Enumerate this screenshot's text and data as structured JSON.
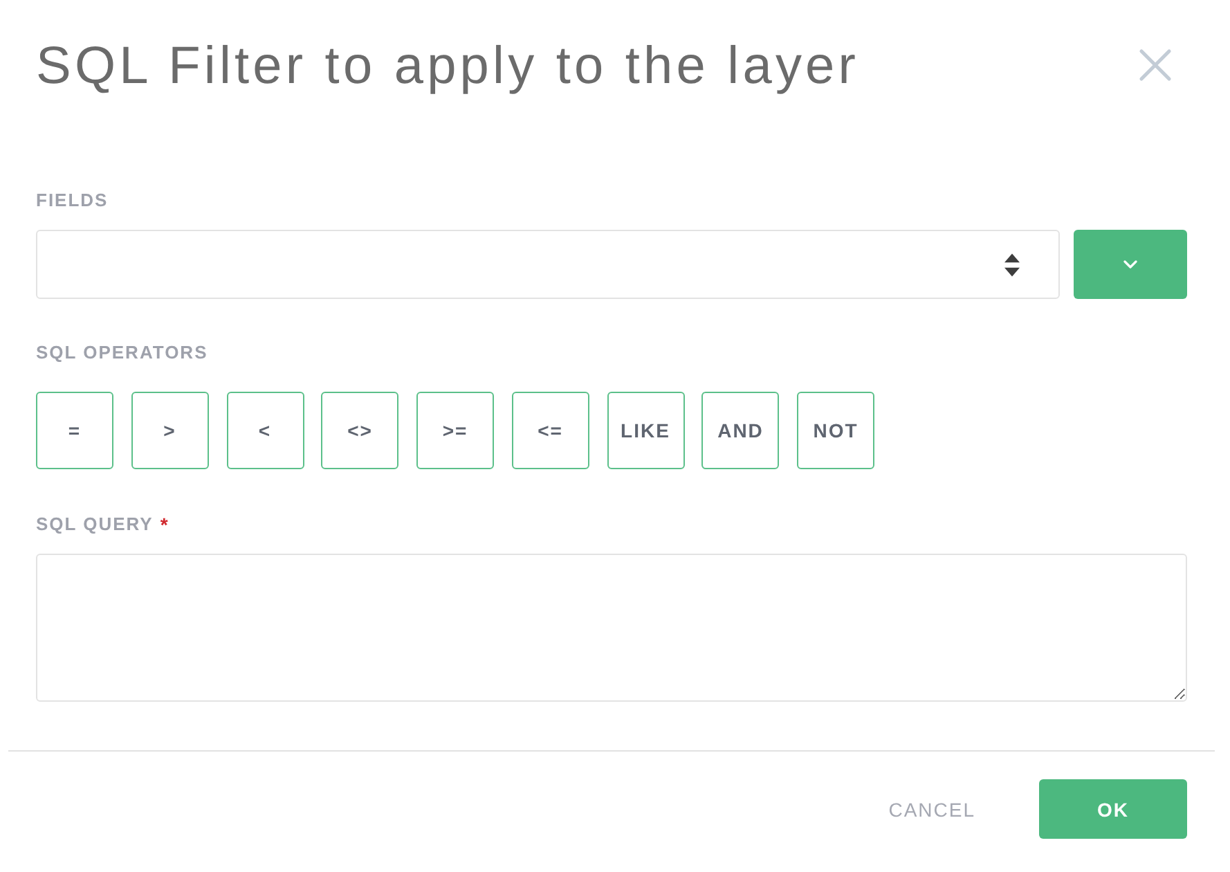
{
  "dialog": {
    "title": "SQL Filter to apply to the layer"
  },
  "fields": {
    "label": "FIELDS"
  },
  "operators": {
    "label": "SQL OPERATORS",
    "buttons": [
      "=",
      ">",
      "<",
      "<>",
      ">=",
      "<=",
      "LIKE",
      "AND",
      "NOT"
    ]
  },
  "query": {
    "label": "SQL QUERY",
    "required_mark": "*"
  },
  "footer": {
    "buttons": [
      {
        "label": "CANCEL",
        "kind": "text"
      },
      {
        "label": "OK",
        "kind": "primary"
      }
    ]
  }
}
